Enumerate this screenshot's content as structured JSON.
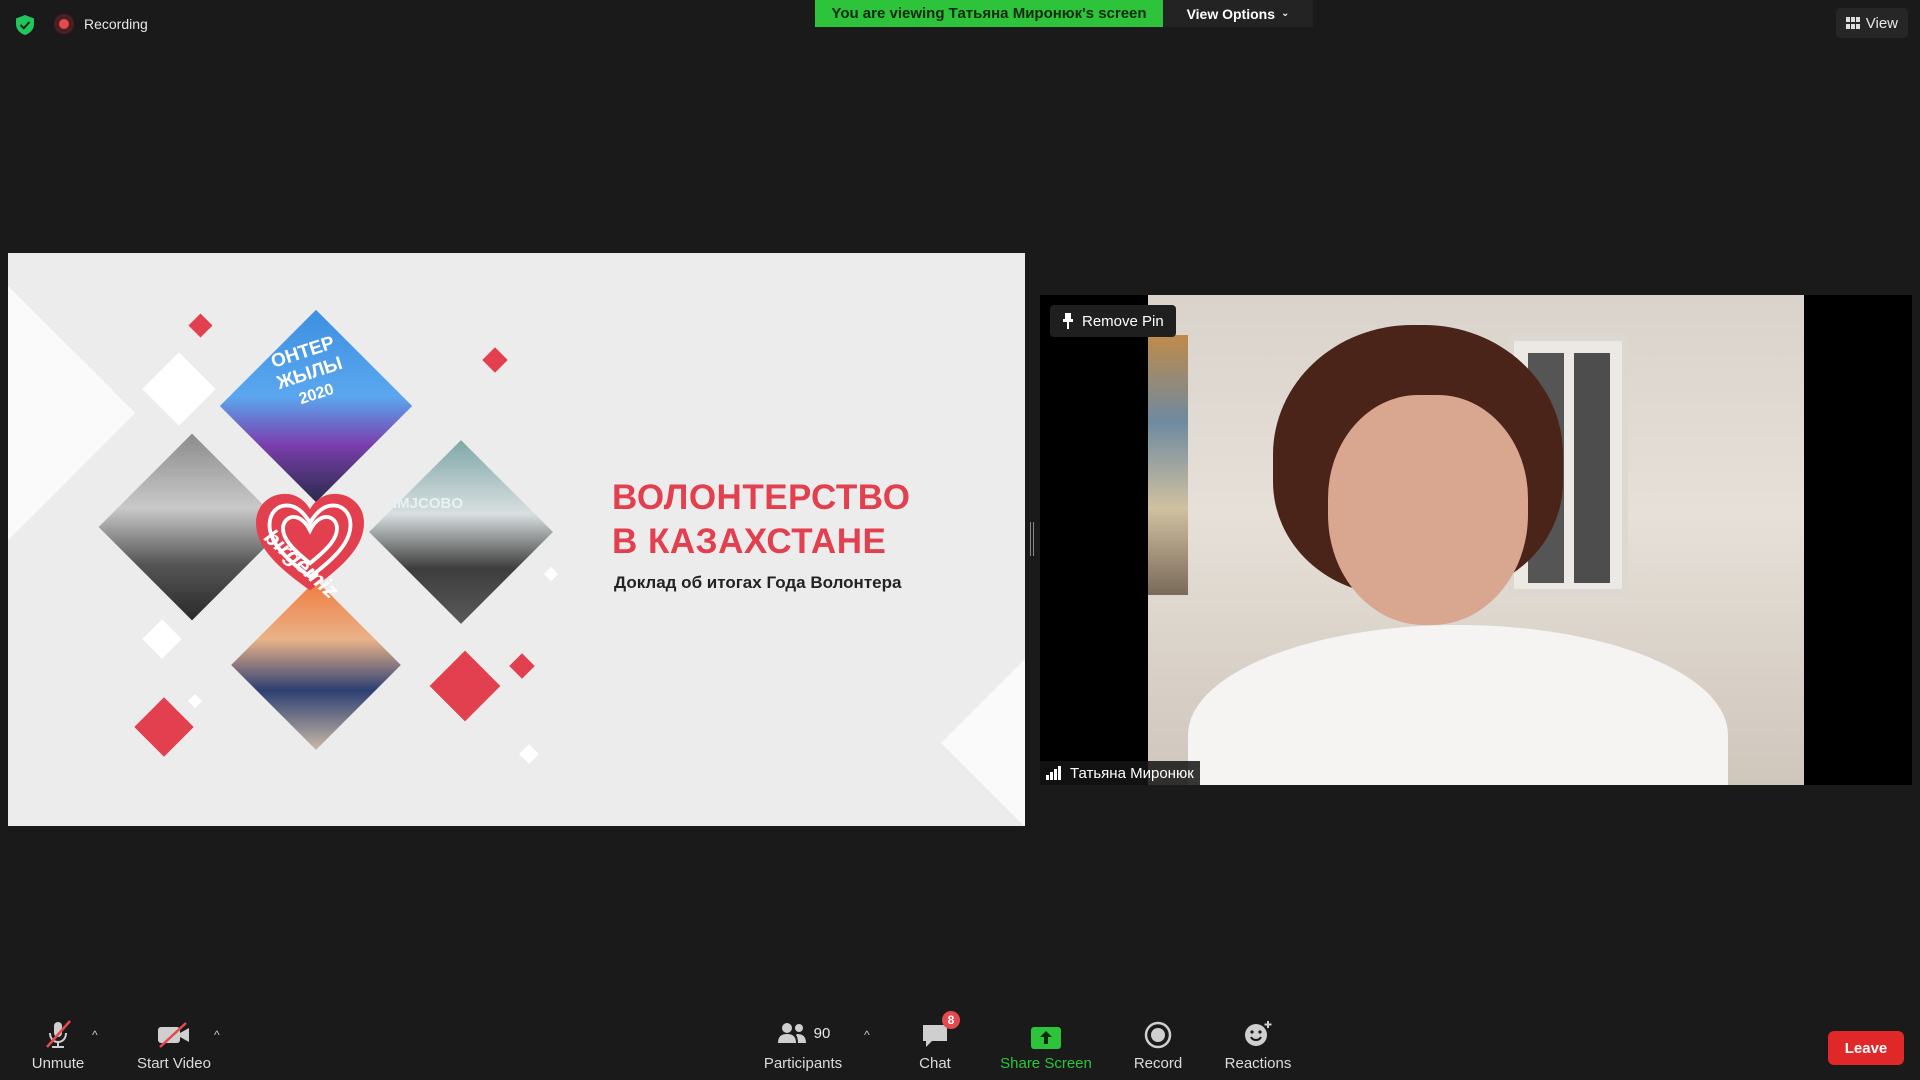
{
  "top": {
    "recording_label": "Recording",
    "viewing_banner": "You are viewing Татьяна Миронюк's screen",
    "view_options_label": "View Options",
    "view_label": "View"
  },
  "slide": {
    "title_line1": "ВОЛОНТЕРСТВО",
    "title_line2": "В КАЗАХСТАНЕ",
    "subtitle": "Доклад об итогах Года Волонтера",
    "logo_text": "birgemiz",
    "photo_text_top": "ОНТЕР",
    "photo_text_mid": "ЖЫЛЫ",
    "photo_text_year": "2020",
    "photo_text_board": "IMJCOBO"
  },
  "video": {
    "remove_pin_label": "Remove Pin",
    "participant_name": "Татьяна Миронюк"
  },
  "toolbar": {
    "unmute": "Unmute",
    "start_video": "Start Video",
    "participants": "Participants",
    "participants_count": "90",
    "chat": "Chat",
    "chat_badge": "8",
    "share_screen": "Share Screen",
    "record": "Record",
    "reactions": "Reactions",
    "leave": "Leave"
  },
  "colors": {
    "accent_green": "#2dc43c",
    "slide_red": "#e2404e",
    "leave_red": "#e02828",
    "background": "#1a1a1a"
  }
}
